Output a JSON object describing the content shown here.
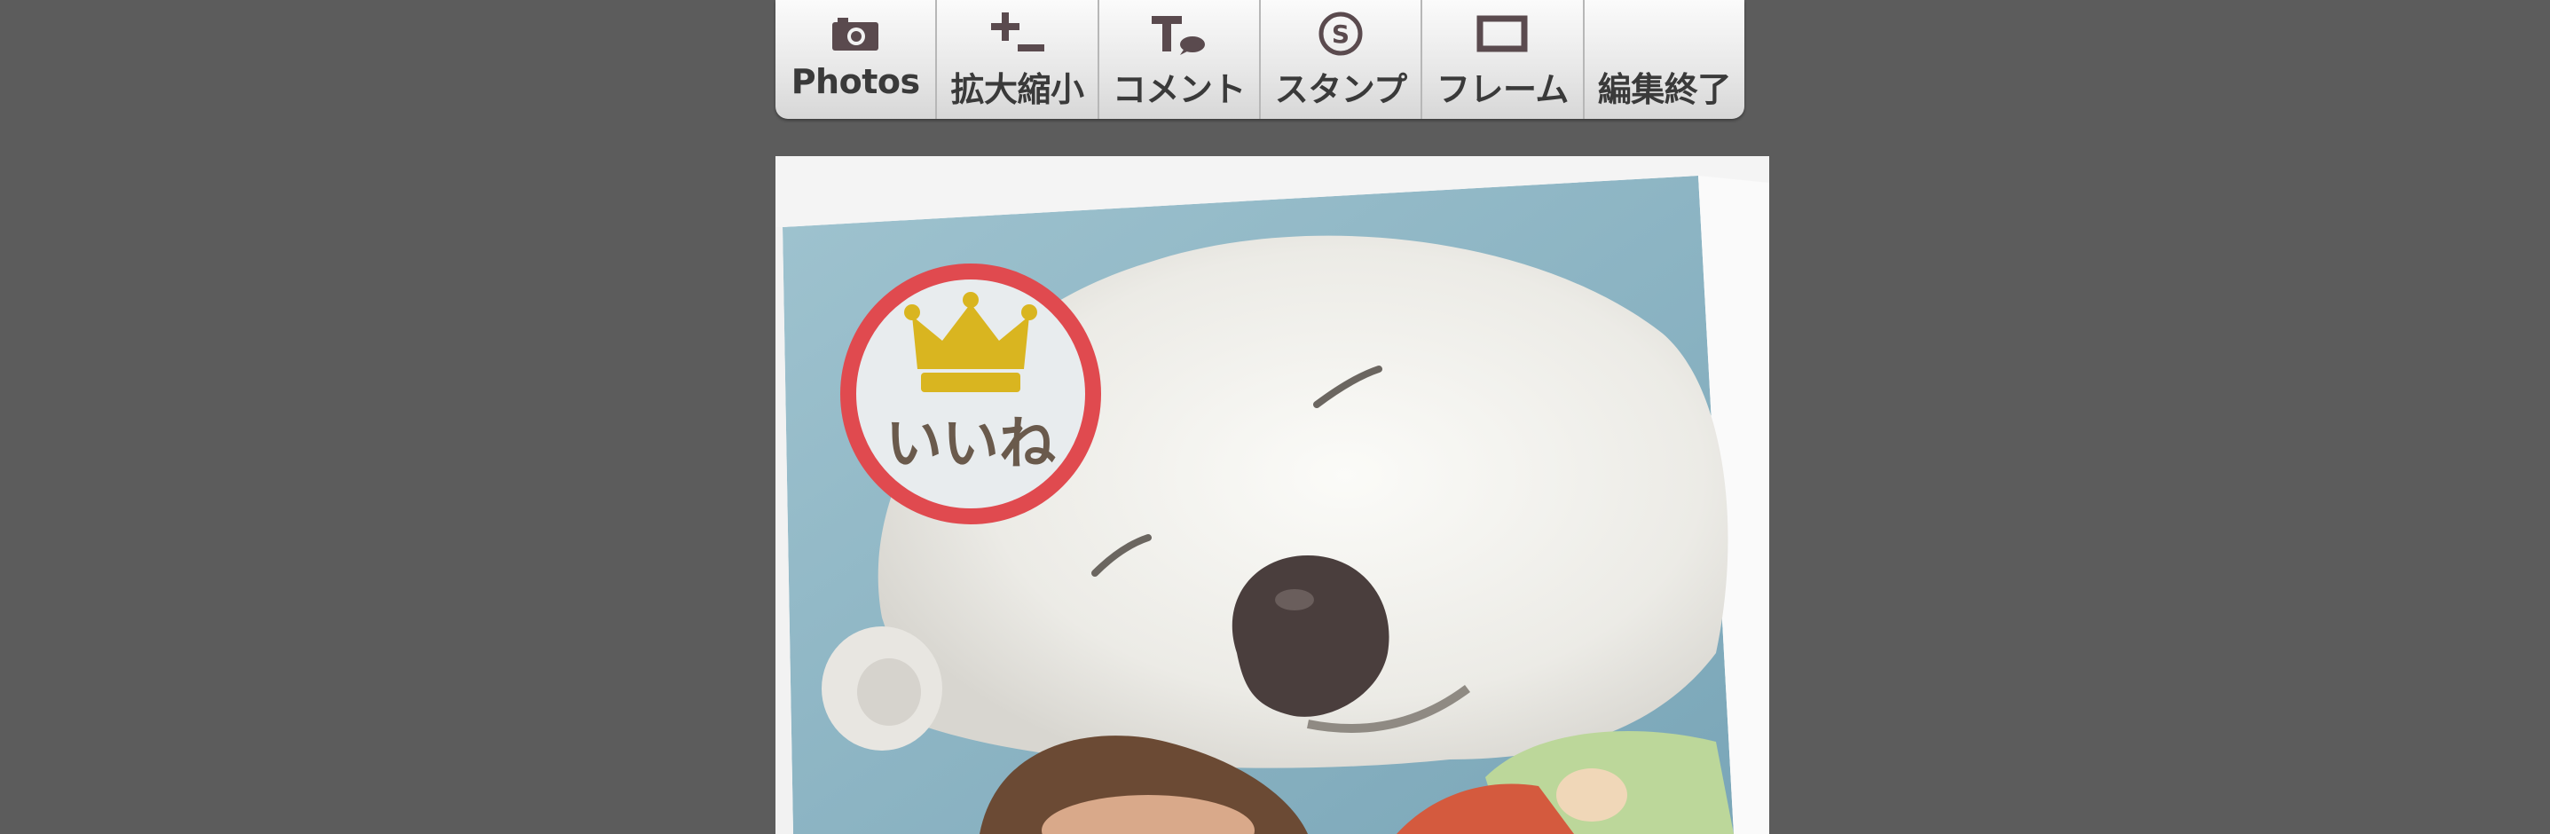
{
  "toolbar": {
    "items": [
      {
        "label": "Photos",
        "icon": "camera-icon"
      },
      {
        "label": "拡大縮小",
        "icon": "zoom-plus-minus-icon"
      },
      {
        "label": "コメント",
        "icon": "text-comment-icon"
      },
      {
        "label": "スタンプ",
        "icon": "stamp-s-icon"
      },
      {
        "label": "フレーム",
        "icon": "frame-icon"
      },
      {
        "label": "編集終了",
        "icon": ""
      }
    ],
    "icon_color": "#5a4a4e"
  },
  "canvas": {
    "photo": "sleeping-polar-bear-on-child",
    "stamp": {
      "text": "いいね",
      "icon": "crown-icon",
      "ring_color": "#e04a4f",
      "crown_color": "#d9b520"
    }
  }
}
